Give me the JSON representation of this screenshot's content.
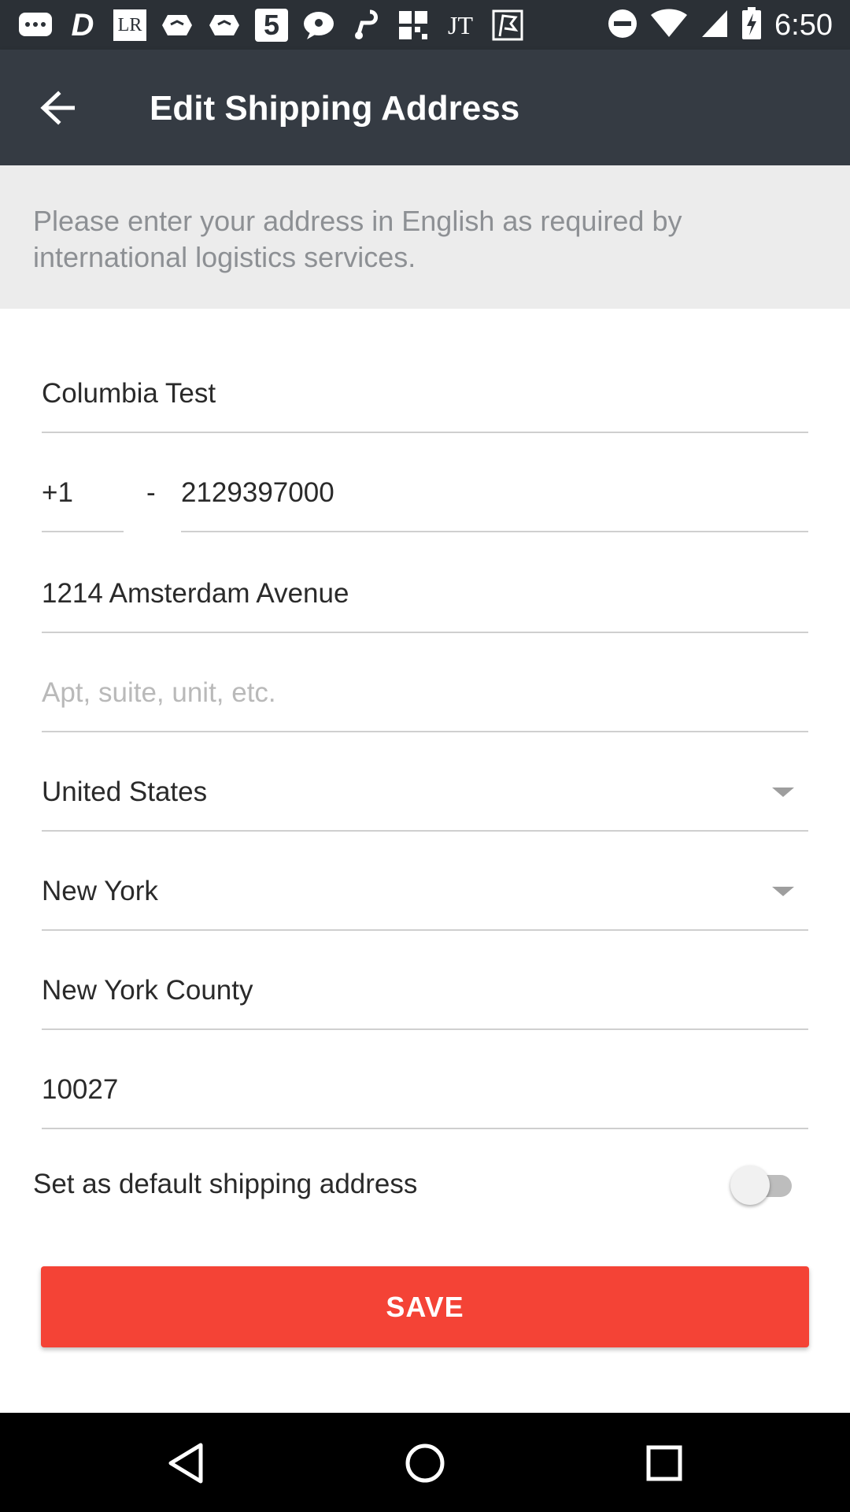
{
  "status_bar": {
    "time": "6:50",
    "left_icons": [
      "message-icon",
      "d-app-icon",
      "lr-app-icon",
      "box-icon",
      "box2-icon",
      "five-app-icon",
      "chat-icon",
      "music-app-icon",
      "grid-app-icon",
      "jt-app-icon",
      "flag-app-icon"
    ],
    "right_icons": [
      "do-not-disturb-icon",
      "wifi-icon",
      "signal-icon",
      "battery-charging-icon"
    ],
    "lr_text": "LR",
    "jt_text": "JT",
    "five_text": "5",
    "d_text": "D"
  },
  "app_bar": {
    "title": "Edit Shipping Address"
  },
  "notice": {
    "text": "Please enter your address in English as required by international logistics services."
  },
  "form": {
    "name": "Columbia Test",
    "phone_code": "+1",
    "phone_separator": "-",
    "phone_number": "2129397000",
    "street": "1214 Amsterdam Avenue",
    "apt_placeholder": "Apt, suite, unit, etc.",
    "country": "United States",
    "state": "New York",
    "city": "New York County",
    "zip": "10027"
  },
  "default_toggle": {
    "label": "Set as default shipping address",
    "on": false
  },
  "save_button": {
    "label": "SAVE"
  },
  "colors": {
    "status_bar": "#2b3036",
    "app_bar": "#353b43",
    "notice_bg": "#ececec",
    "accent": "#f44336"
  }
}
